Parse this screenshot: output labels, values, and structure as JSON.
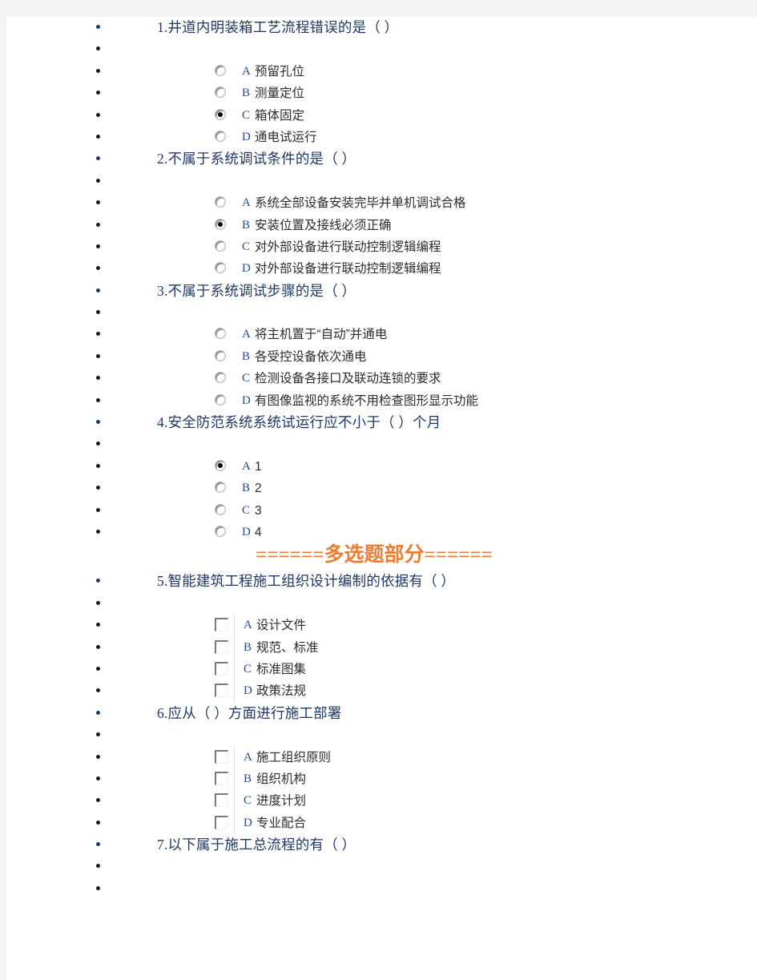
{
  "document": {
    "section_header": "======多选题部分======",
    "section_header_color": "#ED7D31",
    "question_color": "#1F3864",
    "option_letter_color": "#2B4A8B"
  },
  "questions": [
    {
      "number": "1.",
      "text": "井道内明装箱工艺流程错误的是（ ）",
      "type": "single",
      "options": [
        {
          "letter": "A",
          "text": "预留孔位",
          "checked": false
        },
        {
          "letter": "B",
          "text": "测量定位",
          "checked": false
        },
        {
          "letter": "C",
          "text": "箱体固定",
          "checked": true
        },
        {
          "letter": "D",
          "text": "通电试运行",
          "checked": false
        }
      ]
    },
    {
      "number": "2.",
      "text": "不属于系统调试条件的是（ ）",
      "type": "single",
      "options": [
        {
          "letter": "A",
          "text": "系统全部设备安装完毕并单机调试合格",
          "checked": false
        },
        {
          "letter": "B",
          "text": "安装位置及接线必须正确",
          "checked": true
        },
        {
          "letter": "C",
          "text": "对外部设备进行联动控制逻辑编程",
          "checked": false
        },
        {
          "letter": "D",
          "text": "对外部设备进行联动控制逻辑编程",
          "checked": false
        }
      ]
    },
    {
      "number": "3.",
      "text": "不属于系统调试步骤的是（ ）",
      "type": "single",
      "options": [
        {
          "letter": "A",
          "text": "将主机置于“自动”并通电",
          "checked": false
        },
        {
          "letter": "B",
          "text": "各受控设备依次通电",
          "checked": false
        },
        {
          "letter": "C",
          "text": "检测设备各接口及联动连锁的要求",
          "checked": false
        },
        {
          "letter": "D",
          "text": "有图像监视的系统不用检查图形显示功能",
          "checked": false
        }
      ]
    },
    {
      "number": "4.",
      "text": "安全防范系统系统试运行应不小于（ ）个月",
      "type": "single",
      "options": [
        {
          "letter": "A",
          "text": "1",
          "checked": true
        },
        {
          "letter": "B",
          "text": "2",
          "checked": false
        },
        {
          "letter": "C",
          "text": "3",
          "checked": false
        },
        {
          "letter": "D",
          "text": "4",
          "checked": false
        }
      ]
    },
    {
      "number": "5.",
      "text": "智能建筑工程施工组织设计编制的依据有（ ）",
      "type": "multiple",
      "options": [
        {
          "letter": "A",
          "text": "设计文件",
          "checked": false
        },
        {
          "letter": "B",
          "text": "规范、标准",
          "checked": false
        },
        {
          "letter": "C",
          "text": "标准图集",
          "checked": false
        },
        {
          "letter": "D",
          "text": "政策法规",
          "checked": false
        }
      ]
    },
    {
      "number": "6.",
      "text": "应从（ ）方面进行施工部署",
      "type": "multiple",
      "options": [
        {
          "letter": "A",
          "text": "施工组织原则",
          "checked": false
        },
        {
          "letter": "B",
          "text": "组织机构",
          "checked": false
        },
        {
          "letter": "C",
          "text": "进度计划",
          "checked": false
        },
        {
          "letter": "D",
          "text": "专业配合",
          "checked": false
        }
      ]
    },
    {
      "number": "7.",
      "text": "以下属于施工总流程的有（ ）",
      "type": "multiple",
      "options": []
    }
  ]
}
